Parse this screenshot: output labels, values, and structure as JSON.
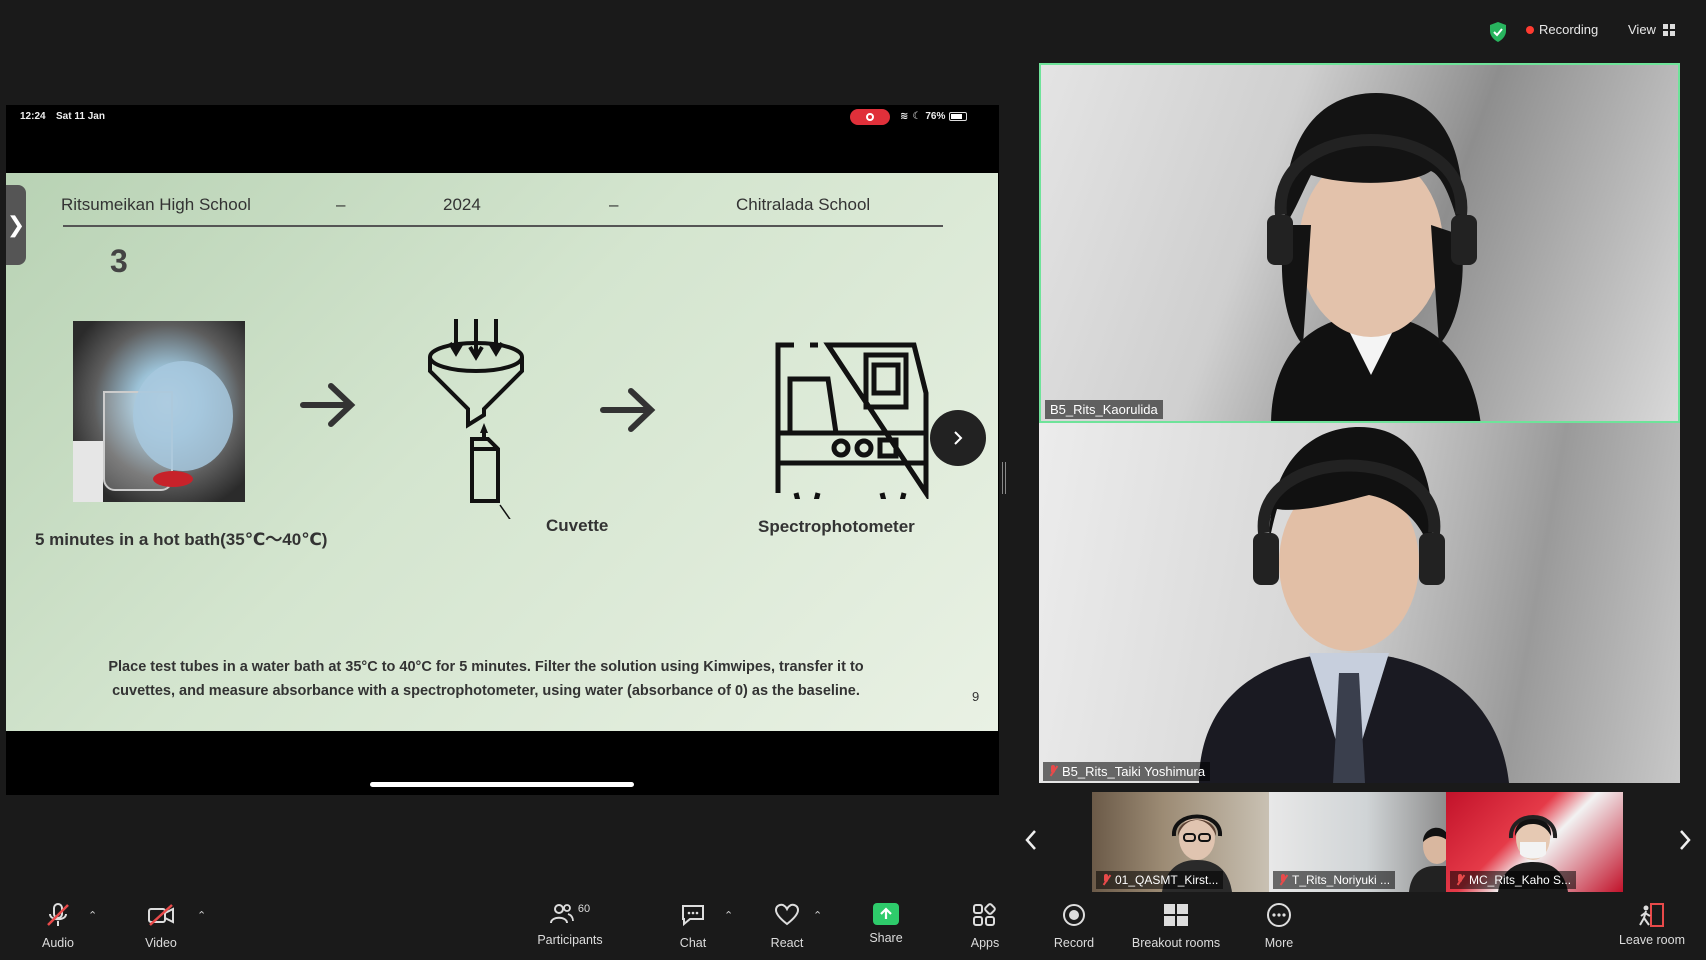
{
  "topbar": {
    "recording_label": "Recording",
    "view_label": "View"
  },
  "ipad": {
    "time": "12:24",
    "date": "Sat 11 Jan",
    "battery": "76%"
  },
  "slide": {
    "header_left": "Ritsumeikan High School",
    "header_dash": "–",
    "header_year": "2024",
    "header_right": "Chitralada School",
    "step_number": "3",
    "caption_bath": "5 minutes in a hot bath(35℃〜40℃)",
    "caption_cuvette": "Cuvette",
    "caption_spectro": "Spectrophotometer",
    "body_line1": "Place test tubes in a water bath at 35°C to 40°C for 5 minutes. Filter the solution using Kimwipes, transfer it to",
    "body_line2": "cuvettes, and measure absorbance with a spectrophotometer, using water (absorbance of 0) as the baseline.",
    "page_number": "9"
  },
  "participants": {
    "tile1_name": "B5_Rits_Kaorulida",
    "tile2_name": "B5_Rits_Taiki Yoshimura",
    "thumb1_name": "01_QASMT_Kirst...",
    "thumb2_name": "T_Rits_Noriyuki ...",
    "thumb3_name": "MC_Rits_Kaho S..."
  },
  "toolbar": {
    "audio": "Audio",
    "video": "Video",
    "participants": "Participants",
    "participants_count": "60",
    "chat": "Chat",
    "react": "React",
    "share": "Share",
    "apps": "Apps",
    "record": "Record",
    "breakout": "Breakout rooms",
    "more": "More",
    "leave": "Leave room"
  },
  "colors": {
    "active_speaker": "#6fe39a",
    "share_green": "#2ecb6b",
    "recording_red": "#ff3b30"
  }
}
